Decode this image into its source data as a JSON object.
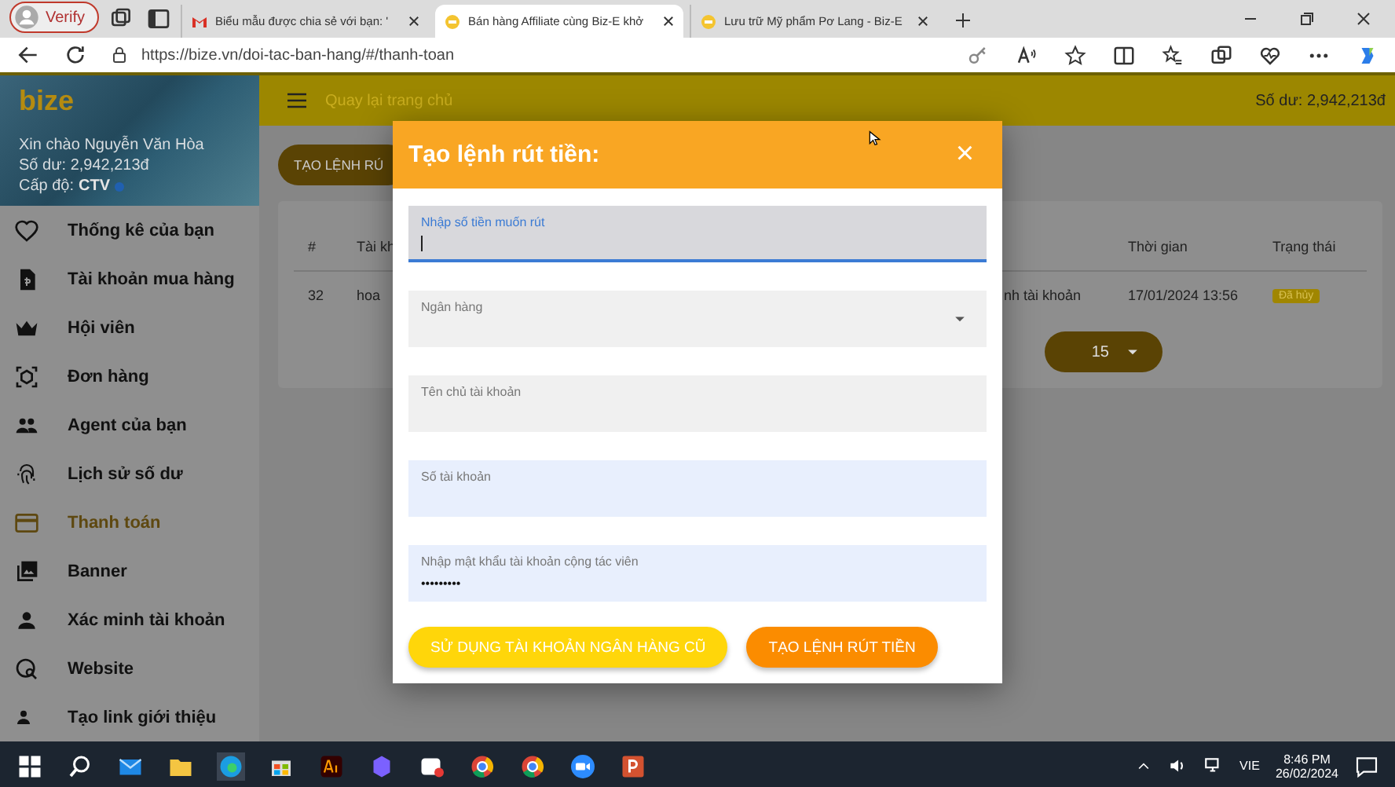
{
  "browser": {
    "profile": "Verify",
    "tabs": [
      {
        "title": "Biểu mẫu được chia sẻ với bạn: '",
        "kind": "mail",
        "selected": false
      },
      {
        "title": "Bán hàng Affiliate cùng Biz-E khở",
        "kind": "site",
        "selected": true
      },
      {
        "title": "Lưu trữ Mỹ phẩm Pơ Lang - Biz-E",
        "kind": "site",
        "selected": false
      }
    ],
    "url": "https://bize.vn/doi-tac-ban-hang/#/thanh-toan"
  },
  "sidebar": {
    "logo": "bize",
    "greeting": "Xin chào Nguyễn Văn Hòa",
    "balance": "Số dư: 2,942,213đ",
    "level_label": "Cấp độ:",
    "level": "CTV",
    "items": [
      {
        "label": "Thống kê của bạn",
        "selected": false
      },
      {
        "label": "Tài khoản mua hàng",
        "selected": false
      },
      {
        "label": "Hội viên",
        "selected": false
      },
      {
        "label": "Đơn hàng",
        "selected": false
      },
      {
        "label": "Agent của bạn",
        "selected": false
      },
      {
        "label": "Lịch sử số dư",
        "selected": false
      },
      {
        "label": "Thanh toán",
        "selected": true
      },
      {
        "label": "Banner",
        "selected": false
      },
      {
        "label": "Xác minh tài khoản",
        "selected": false
      },
      {
        "label": "Website",
        "selected": false
      },
      {
        "label": "Tạo link giới thiệu",
        "selected": false
      }
    ]
  },
  "header": {
    "back_link": "Quay lại trang chủ",
    "balance": "Số dư: 2,942,213đ"
  },
  "content": {
    "create_button": "TẠO LỆNH RÚ",
    "table": {
      "columns": [
        "#",
        "Tài kh",
        "",
        "Thời gian",
        "Trạng thái"
      ],
      "rows": [
        {
          "cells": [
            "32",
            "hoa",
            "nh tài khoản",
            "17/01/2024 13:56"
          ],
          "status": "Đã hủy"
        }
      ]
    },
    "page_size": "15"
  },
  "dialog": {
    "title": "Tạo lệnh rút tiền:",
    "close": "×",
    "fields": [
      {
        "kind": "text",
        "label": "Nhập số tiền muốn rút",
        "focused": true,
        "autofilled": false
      },
      {
        "kind": "select",
        "label": "Ngân hàng",
        "focused": false,
        "autofilled": false
      },
      {
        "kind": "text",
        "label": "Tên chủ tài khoản",
        "focused": false,
        "autofilled": false
      },
      {
        "kind": "text",
        "label": "Số tài khoản",
        "focused": false,
        "autofilled": true
      },
      {
        "kind": "password",
        "label": "Nhập mật khẩu tài khoản cộng tác viên",
        "value": "•••••••••",
        "focused": false,
        "autofilled": true
      }
    ],
    "buttons": [
      {
        "label": "SỬ DỤNG TÀI KHOẢN NGÂN HÀNG CŨ",
        "kind": "secondary"
      },
      {
        "label": "TẠO LỆNH RÚT TIỀN",
        "kind": "primary"
      }
    ]
  },
  "taskbar": {
    "language": "VIE",
    "time": "8:46 PM",
    "date": "26/02/2024"
  }
}
